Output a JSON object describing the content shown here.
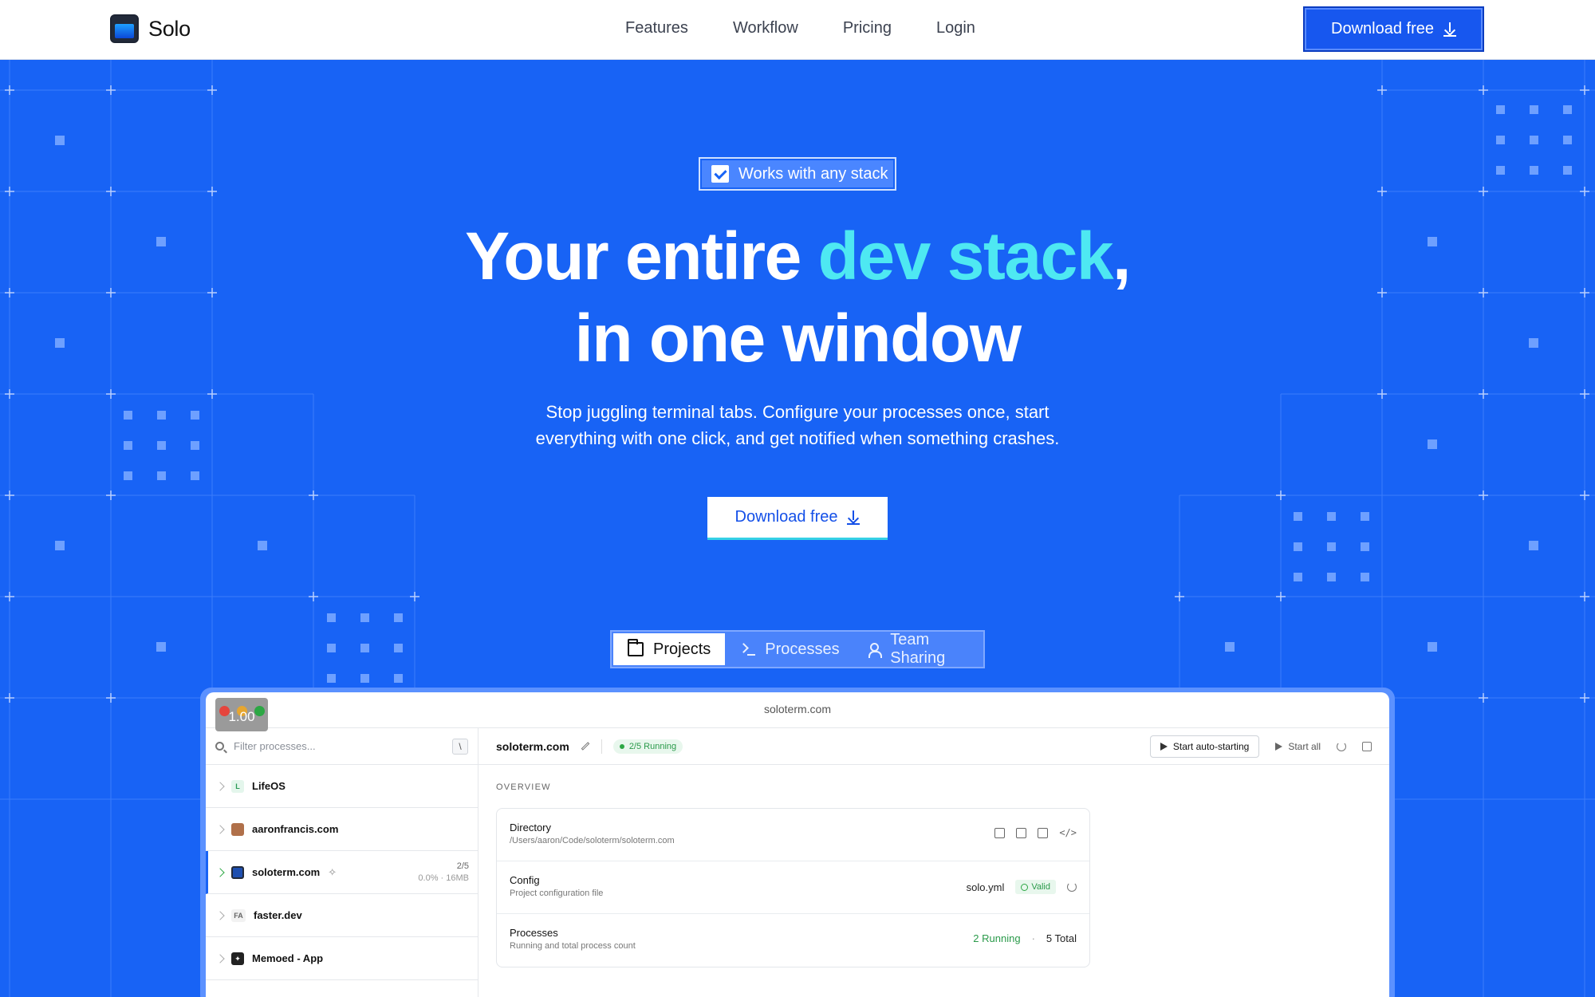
{
  "nav": {
    "brand": "Solo",
    "links": [
      "Features",
      "Workflow",
      "Pricing",
      "Login"
    ],
    "cta_label": "Download free"
  },
  "hero": {
    "badge": "Works with any stack",
    "headline_part1": "Your entire ",
    "headline_accent": "dev stack",
    "headline_part2": ",",
    "headline_line2": "in one window",
    "subtitle_line1": "Stop juggling terminal tabs. Configure your processes once, start",
    "subtitle_line2": "everything with one click, and get notified when something crashes.",
    "cta_label": "Download free",
    "accent_color": "#4ee8f2",
    "background_color": "#1863f5"
  },
  "tabs": [
    {
      "label": "Projects",
      "icon": "folder-icon",
      "active": true
    },
    {
      "label": "Processes",
      "icon": "terminal-icon",
      "active": false
    },
    {
      "label": "Team Sharing",
      "icon": "users-icon",
      "active": false
    }
  ],
  "app": {
    "window_title": "soloterm.com",
    "zoom_badge": "1.00",
    "filter_placeholder": "Filter processes...",
    "filter_shortcut": "\\",
    "projects": [
      {
        "name": "LifeOS",
        "icon_text": "L"
      },
      {
        "name": "aaronfrancis.com",
        "icon_text": ""
      },
      {
        "name": "soloterm.com",
        "icon_text": "",
        "count": "2/5",
        "usage": "0.0% · 16MB",
        "active": true
      },
      {
        "name": "faster.dev",
        "icon_text": "FA"
      },
      {
        "name": "Memoed - App",
        "icon_text": "✦"
      }
    ],
    "header": {
      "title": "soloterm.com",
      "status": "2/5 Running",
      "start_auto": "Start auto-starting",
      "start_all": "Start all"
    },
    "overview_label": "OVERVIEW",
    "overview": {
      "directory_title": "Directory",
      "directory_path": "/Users/aaron/Code/soloterm/soloterm.com",
      "config_title": "Config",
      "config_sub": "Project configuration file",
      "config_file": "solo.yml",
      "config_status": "Valid",
      "processes_title": "Processes",
      "processes_sub": "Running and total process count",
      "processes_running": "2 Running",
      "processes_total": "5 Total"
    }
  }
}
